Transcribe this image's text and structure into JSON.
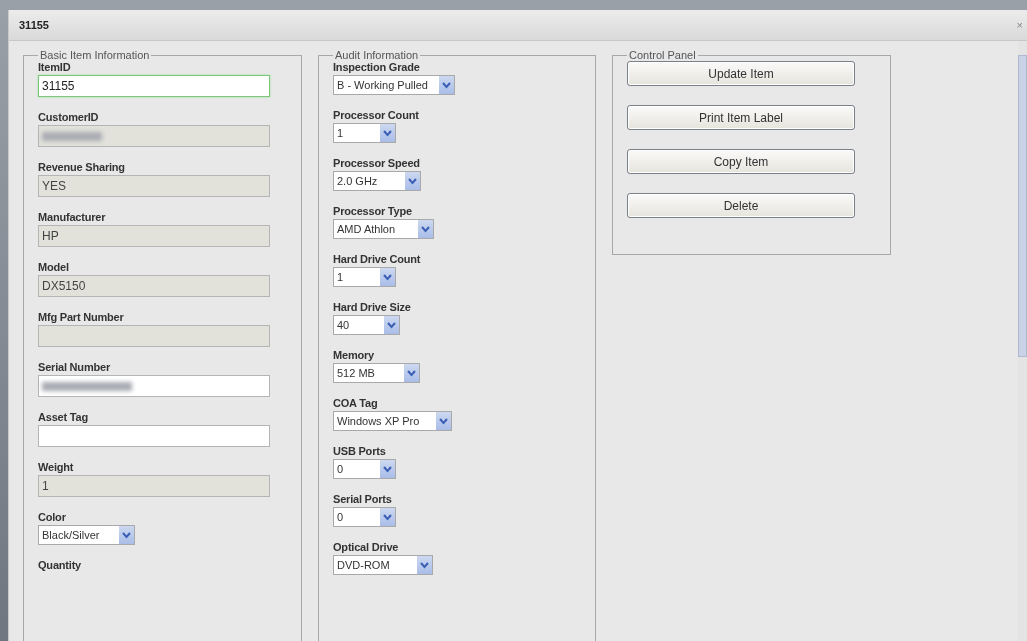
{
  "window": {
    "title": "31155",
    "close": "×"
  },
  "basic": {
    "legend": "Basic Item Information",
    "fields": [
      {
        "label": "ItemID",
        "kind": "text",
        "value": "31155",
        "disabled": false,
        "focused": true
      },
      {
        "label": "CustomerID",
        "kind": "redacted",
        "disabled": true
      },
      {
        "label": "Revenue Sharing",
        "kind": "text",
        "value": "YES",
        "disabled": true,
        "focused": false
      },
      {
        "label": "Manufacturer",
        "kind": "text",
        "value": "HP",
        "disabled": true,
        "focused": false
      },
      {
        "label": "Model",
        "kind": "text",
        "value": "DX5150",
        "disabled": true,
        "focused": false
      },
      {
        "label": "Mfg Part Number",
        "kind": "text",
        "disabled": true,
        "focused": false
      },
      {
        "label": "Serial Number",
        "kind": "redacted",
        "disabled": false
      },
      {
        "label": "Asset Tag",
        "kind": "text",
        "disabled": false,
        "focused": false
      },
      {
        "label": "Weight",
        "kind": "text",
        "value": "1",
        "disabled": true,
        "focused": false
      },
      {
        "label": "Color",
        "kind": "select",
        "value": "Black/Silver"
      },
      {
        "label": "Quantity",
        "kind": "label"
      }
    ]
  },
  "audit": {
    "legend": "Audit Information",
    "fields": [
      {
        "label": "Inspection Grade",
        "kind": "select",
        "value": "B - Working Pulled"
      },
      {
        "label": "Processor Count",
        "kind": "select",
        "value": "1"
      },
      {
        "label": "Processor Speed",
        "kind": "select",
        "value": "2.0 GHz"
      },
      {
        "label": "Processor Type",
        "kind": "select",
        "value": "AMD Athlon"
      },
      {
        "label": "Hard Drive Count",
        "kind": "select",
        "value": "1"
      },
      {
        "label": "Hard Drive Size",
        "kind": "select",
        "value": "40"
      },
      {
        "label": "Memory",
        "kind": "select",
        "value": "512 MB"
      },
      {
        "label": "COA Tag",
        "kind": "select",
        "value": "Windows XP Pro"
      },
      {
        "label": "USB Ports",
        "kind": "select",
        "value": "0"
      },
      {
        "label": "Serial Ports",
        "kind": "select",
        "value": "0"
      },
      {
        "label": "Optical Drive",
        "kind": "select",
        "value": "DVD-ROM"
      }
    ]
  },
  "control_panel": {
    "legend": "Control Panel",
    "buttons": [
      "Update Item",
      "Print Item Label",
      "Copy Item",
      "Delete"
    ]
  }
}
